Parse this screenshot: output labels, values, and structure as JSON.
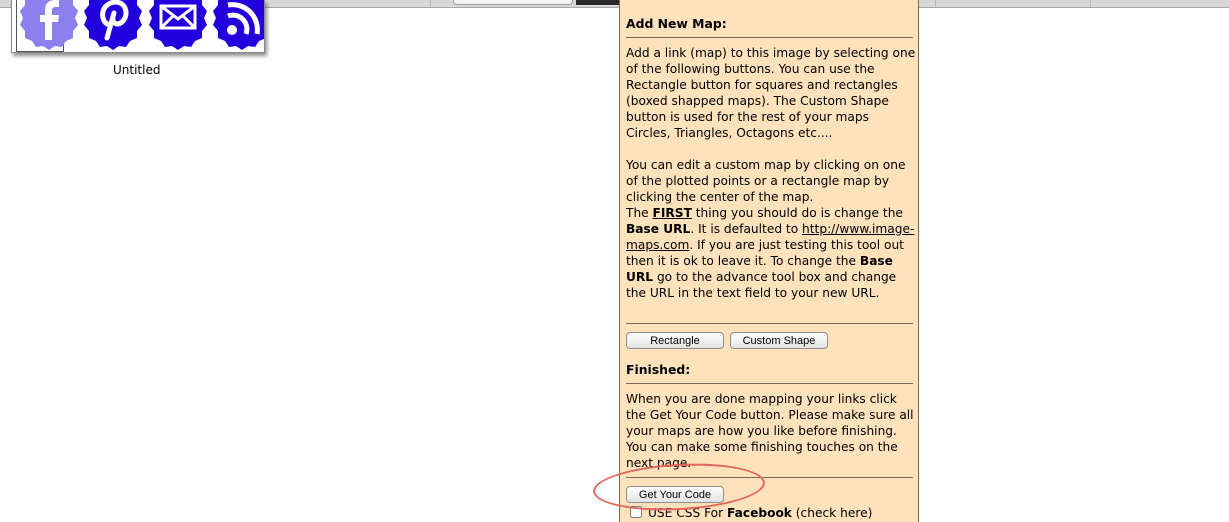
{
  "thumbnail": {
    "icons": [
      "facebook-icon",
      "pinterest-icon",
      "email-icon",
      "rss-icon"
    ],
    "icon_color": "#2200dd",
    "facebook_icon_color": "#8a80ee",
    "label": "Untitled"
  },
  "panel": {
    "background": "#fde2bc",
    "add_map": {
      "heading": "Add New Map:",
      "intro": "Add a link (map) to this image by selecting one of the following buttons. You can use the Rectangle button for squares and rectangles (boxed shapped maps). The Custom Shape button is used for the rest of your maps Circles, Triangles, Octagons etc....",
      "edit_text": "You can edit a custom map by clicking on one of the plotted points or a rectangle map by clicking the center of the map.",
      "the": "The",
      "first": "FIRST",
      "thing_text": "thing you should do is change the",
      "base_url": "Base URL",
      "defaulted_text": ". It is defaulted to",
      "link": "http://www.image-maps.com",
      "testing_text": ". If you are just testing this tool out then it is ok to leave it. To change the",
      "advance_text": "go to the advance tool box and change the URL in the text field to your new URL."
    },
    "buttons": {
      "rectangle": "Rectangle",
      "custom_shape": "Custom Shape",
      "get_code": "Get Your Code"
    },
    "finished": {
      "heading": "Finished:",
      "text": "When you are done mapping your links click the Get Your Code button. Please make sure all your maps are how you like before finishing. You can make some finishing touches on the next page."
    },
    "css_option": {
      "prefix": "USE CSS For",
      "bold": "Facebook",
      "suffix": "(check here)"
    }
  },
  "annotation_color": "#e2675a"
}
